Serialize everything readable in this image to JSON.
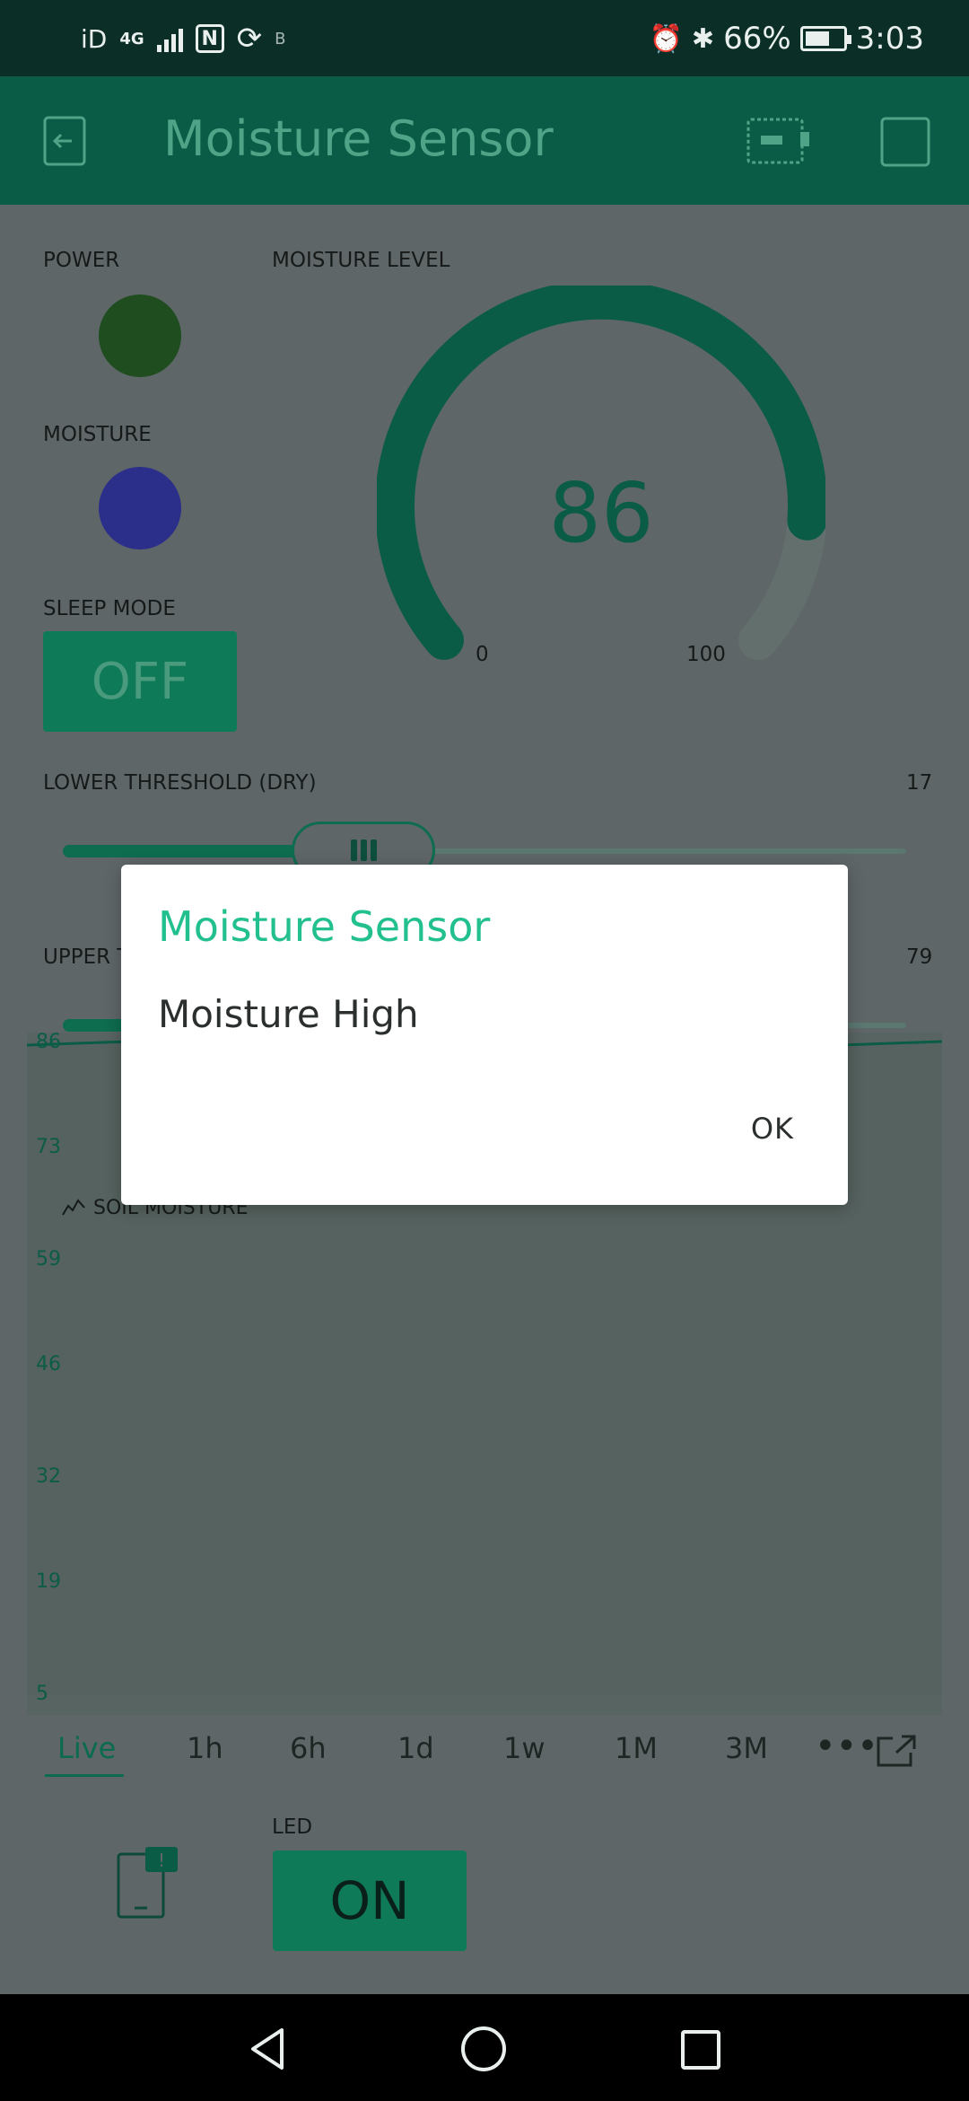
{
  "status_bar": {
    "carrier": "iD",
    "network": "4G",
    "bt_label": "B",
    "battery": "66%",
    "battery_level": 0.66,
    "time": "3:03"
  },
  "app_bar": {
    "title": "Moisture Sensor"
  },
  "widgets": {
    "power_label": "POWER",
    "power_led_color": "#1f4d1f",
    "moisture_label": "MOISTURE",
    "moisture_led_color": "#2c2f8a",
    "sleep_label": "SLEEP MODE",
    "sleep_value": "OFF",
    "gauge_label": "MOISTURE LEVEL",
    "gauge_value": "86",
    "gauge_min": "0",
    "gauge_max": "100",
    "lower_label": "LOWER THRESHOLD (DRY)",
    "lower_value": "17",
    "upper_label_visible": "UPPER T",
    "upper_value": "79",
    "led_label": "LED",
    "led_value": "ON"
  },
  "chart_data": {
    "type": "line",
    "title": "SOIL MOISTURE",
    "y_ticks": [
      "86",
      "73",
      "59",
      "46",
      "32",
      "19",
      "5"
    ],
    "ylim": [
      5,
      86
    ],
    "series": [
      {
        "values": [
          86,
          86,
          86,
          86,
          86,
          86,
          86,
          86,
          86,
          86
        ]
      }
    ]
  },
  "ranges": [
    "Live",
    "1h",
    "6h",
    "1d",
    "1w",
    "1M",
    "3M"
  ],
  "dialog": {
    "title": "Moisture Sensor",
    "message": "Moisture High",
    "ok": "OK"
  },
  "colors": {
    "accent": "#23c08f",
    "appbar": "#0b5c46"
  }
}
